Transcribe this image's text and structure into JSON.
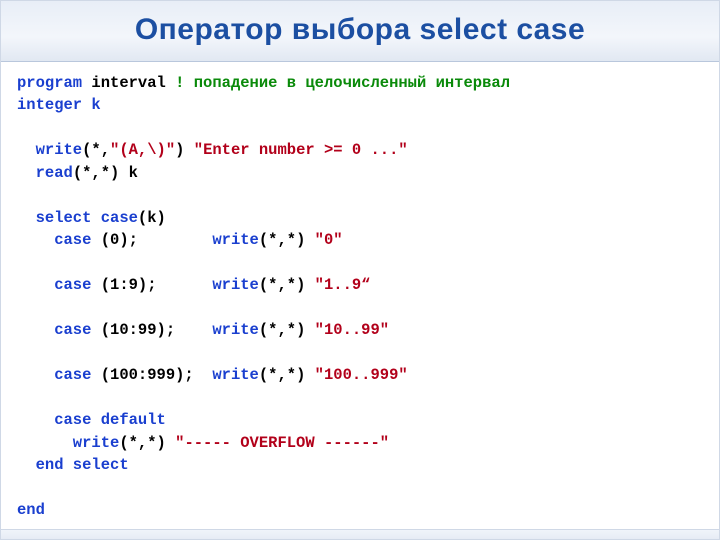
{
  "title": "Оператор выбора select case",
  "code": {
    "line1_program": "program",
    "line1_name": " interval ",
    "line1_comment": "! попадение в целочисленный интервал",
    "line2": "integer k",
    "line3_write": "  write",
    "line3_args": "(*,",
    "line3_fmt": "\"(A,\\)\"",
    "line3_close": ") ",
    "line3_str": "\"Enter number >= 0 ...\"",
    "line4_read": "  read",
    "line4_args": "(*,*) k",
    "line5_select": "  select case",
    "line5_args": "(k)",
    "line6_case": "    case ",
    "line6_args": "(0);        ",
    "line6_write": "write",
    "line6_wa": "(*,*) ",
    "line6_str": "\"0\"",
    "line7_case": "    case ",
    "line7_args": "(1:9);      ",
    "line7_write": "write",
    "line7_wa": "(*,*) ",
    "line7_str": "\"1..9“",
    "line8_case": "    case ",
    "line8_args": "(10:99);    ",
    "line8_write": "write",
    "line8_wa": "(*,*) ",
    "line8_str": "\"10..99\"",
    "line9_case": "    case ",
    "line9_args": "(100:999);  ",
    "line9_write": "write",
    "line9_wa": "(*,*) ",
    "line9_str": "\"100..999\"",
    "line10_default": "    case default",
    "line11_write": "      write",
    "line11_wa": "(*,*) ",
    "line11_str": "\"----- OVERFLOW ------\"",
    "line12_endsel": "  end select",
    "line13_end": "end"
  }
}
